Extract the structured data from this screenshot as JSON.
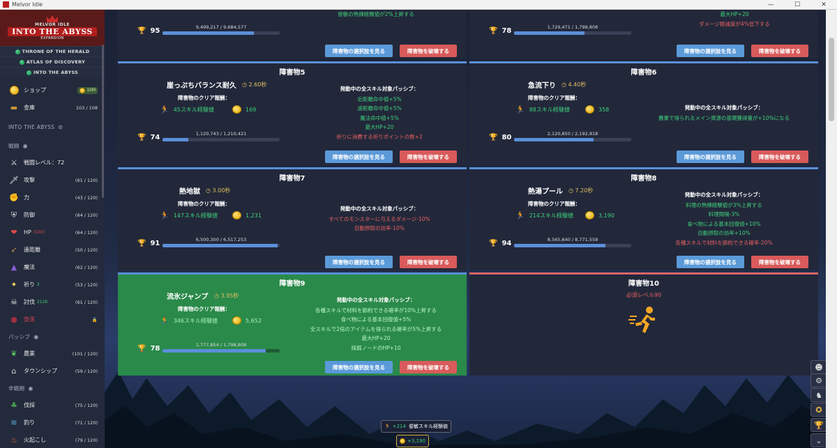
{
  "window": {
    "title": "Melvor Idle",
    "minimize": "—",
    "maximize": "☐",
    "close": "✕"
  },
  "logo": {
    "line1": "MELVOR IDLE",
    "line2": "INTO THE ABYSS",
    "line3": "EXPANSION"
  },
  "expansions": [
    "THRONE OF THE HERALD",
    "ATLAS OF DISCOVERY",
    "INTO THE ABYSS"
  ],
  "sidebar": {
    "shop": {
      "label": "ショップ",
      "gold": "10M"
    },
    "bank": {
      "label": "金庫",
      "count": "103 / 108"
    },
    "section_abyss": "INTO THE ABYSS",
    "section_combat": "戦闘",
    "combat_items": [
      {
        "label": "戦闘レベル：72",
        "count": "",
        "icon": "crossed-swords-icon"
      },
      {
        "label": "攻撃",
        "count": "(61 / 120)",
        "icon": "sword-icon"
      },
      {
        "label": "力",
        "count": "(43 / 120)",
        "icon": "fist-icon"
      },
      {
        "label": "防御",
        "count": "(64 / 120)",
        "icon": "shield-icon"
      },
      {
        "label": "HP",
        "sub": "(530)",
        "count": "(64 / 120)",
        "icon": "heart-icon"
      },
      {
        "label": "遠距離",
        "count": "(50 / 120)",
        "icon": "bow-icon"
      },
      {
        "label": "魔法",
        "count": "(62 / 120)",
        "icon": "wizard-hat-icon"
      },
      {
        "label": "祈り",
        "sub": "2",
        "count": "(53 / 120)",
        "icon": "sparkle-icon"
      },
      {
        "label": "討伐",
        "sub": "212K",
        "count": "(61 / 120)",
        "icon": "slayer-icon"
      },
      {
        "label": "堕落",
        "count": "",
        "icon": "corruption-icon"
      }
    ],
    "section_passive": "パッシブ",
    "passive_items": [
      {
        "label": "農業",
        "count": "(101 / 120)",
        "icon": "sprout-icon"
      },
      {
        "label": "タウンシップ",
        "count": "(59 / 120)",
        "icon": "township-icon"
      }
    ],
    "section_noncombat": "非戦闘",
    "noncombat_items": [
      {
        "label": "伐採",
        "count": "(75 / 120)",
        "icon": "tree-icon"
      },
      {
        "label": "釣り",
        "count": "(71 / 120)",
        "icon": "fishing-icon"
      },
      {
        "label": "火起こし",
        "count": "(79 / 120)",
        "icon": "fire-icon"
      }
    ]
  },
  "buttons": {
    "view": "障害物の選択肢を見る",
    "destroy": "障害物を破壊する"
  },
  "labels": {
    "clear_reward": "障害物のクリア報酬：",
    "passive_header": "発動中の全スキル対象パッシブ："
  },
  "top_left": {
    "partial": "俊敏の熟練経験値が2%上昇する",
    "trophy": "95",
    "progress": "9,499,217 / 9,684,577",
    "fill": 0.78
  },
  "top_right": {
    "partial1": "最大HP+20",
    "partial2": "ダメージ軽減度が4%低下する",
    "trophy": "78",
    "progress": "1,729,471 / 1,798,808",
    "fill": 0.6
  },
  "obstacles": [
    {
      "title": "障害物5",
      "name": "崖っぷちバランス耐久",
      "time": "2.60秒",
      "xp": "45スキル経験値",
      "gp": "169",
      "trophy": "74",
      "progress": "1,120,743 / 1,210,421",
      "fill": 0.22,
      "passives": [
        {
          "t": "近距離命中値+5%",
          "c": "g"
        },
        {
          "t": "遠距離命中値+5%",
          "c": "g"
        },
        {
          "t": "魔法命中値+5%",
          "c": "g"
        },
        {
          "t": "最大HP+20",
          "c": "g"
        },
        {
          "t": "祈りに消費する祈りポイントの数+2",
          "c": "r"
        }
      ]
    },
    {
      "title": "障害物6",
      "name": "急流下り",
      "time": "4.40秒",
      "xp": "88スキル経験値",
      "gp": "358",
      "trophy": "80",
      "progress": "2,120,850 / 2,192,818",
      "fill": 0.68,
      "passives": [
        {
          "t": "農業で得られるメイン資源の基礎獲得量が+10%になる",
          "c": "g"
        }
      ]
    },
    {
      "title": "障害物7",
      "name": "熱地獄",
      "time": "3.00秒",
      "xp": "147スキル経験値",
      "gp": "1,231",
      "trophy": "91",
      "progress": "6,500,300 / 6,517,253",
      "fill": 0.98,
      "passives": [
        {
          "t": "すべてのモンスターに与えるダメージ-10%",
          "c": "r"
        },
        {
          "t": "自動摂取の効率-10%",
          "c": "r"
        }
      ]
    },
    {
      "title": "障害物8",
      "name": "熱湯プール",
      "time": "7.20秒",
      "xp": "214スキル経験値",
      "gp": "3,190",
      "trophy": "94",
      "progress": "8,565,640 / 8,771,558",
      "fill": 0.78,
      "passives": [
        {
          "t": "料理の熟練経験値が3%上昇する",
          "c": "g"
        },
        {
          "t": "料理間隔-3%",
          "c": "g"
        },
        {
          "t": "食べ物による基本回復値+10%",
          "c": "g"
        },
        {
          "t": "自動摂取の効率+10%",
          "c": "g"
        },
        {
          "t": "各種スキルで材料を節約できる確率-20%",
          "c": "r"
        }
      ]
    },
    {
      "title": "障害物9",
      "name": "流氷ジャンプ",
      "time": "3.95秒",
      "xp": "346スキル経験値",
      "gp": "5,652",
      "trophy": "78",
      "progress": "1,777,854 / 1,798,808",
      "fill": 0.88,
      "passives": [
        {
          "t": "各種スキルで材料を節約できる確率が10%上昇する",
          "c": "g"
        },
        {
          "t": "食べ物による基本回復値+5%",
          "c": "g"
        },
        {
          "t": "全スキルで2倍のアイテムを得られる確率が5%上昇する",
          "c": "g"
        },
        {
          "t": "最大HP+20",
          "c": "g"
        },
        {
          "t": "採掘ノードのHP+10",
          "c": "g"
        }
      ]
    }
  ],
  "obstacle10": {
    "title": "障害物10",
    "req": "必須レベル90"
  },
  "toasts": {
    "xp_amount": "+214",
    "xp_label": "俊敏スキル経験値",
    "gp_amount": "+3,190"
  }
}
